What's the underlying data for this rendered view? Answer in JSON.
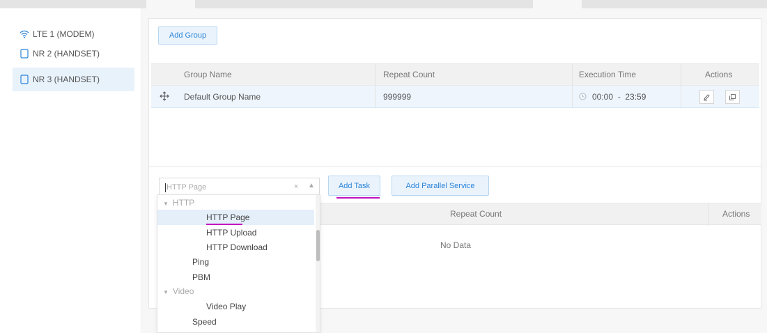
{
  "sidebar": {
    "devices": [
      {
        "label": "LTE 1 (MODEM)",
        "icon": "wifi-icon"
      },
      {
        "label": "NR 2 (HANDSET)",
        "icon": "phone-icon"
      },
      {
        "label": "NR 3 (HANDSET)",
        "icon": "phone-icon",
        "active": true
      }
    ]
  },
  "group_panel": {
    "add_group_label": "Add Group",
    "columns": [
      "Group Name",
      "Repeat Count",
      "Execution Time",
      "Actions"
    ],
    "rows": [
      {
        "name": "Default Group Name",
        "repeat_count": "999999",
        "execution_time": "00:00  -  23:59"
      }
    ]
  },
  "task_panel": {
    "select_placeholder": "HTTP Page",
    "clear_symbol": "×",
    "arrow_symbol": "▲",
    "add_task_label": "Add Task",
    "add_parallel_label": "Add Parallel Service",
    "columns": [
      "Repeat Count",
      "Actions"
    ],
    "empty_text": "No Data"
  },
  "dropdown": {
    "items": [
      {
        "label": "HTTP",
        "type": "group"
      },
      {
        "label": "HTTP Page",
        "type": "option",
        "selected": true
      },
      {
        "label": "HTTP Upload",
        "type": "option"
      },
      {
        "label": "HTTP Download",
        "type": "option"
      },
      {
        "label": "Ping",
        "type": "option"
      },
      {
        "label": "PBM",
        "type": "option"
      },
      {
        "label": "Video",
        "type": "group"
      },
      {
        "label": "Video Play",
        "type": "option"
      },
      {
        "label": "Speed",
        "type": "option"
      }
    ]
  },
  "colors": {
    "accent": "#2b84d8",
    "highlight_underline": "#c010c0",
    "selected_row": "#eef5fd"
  }
}
